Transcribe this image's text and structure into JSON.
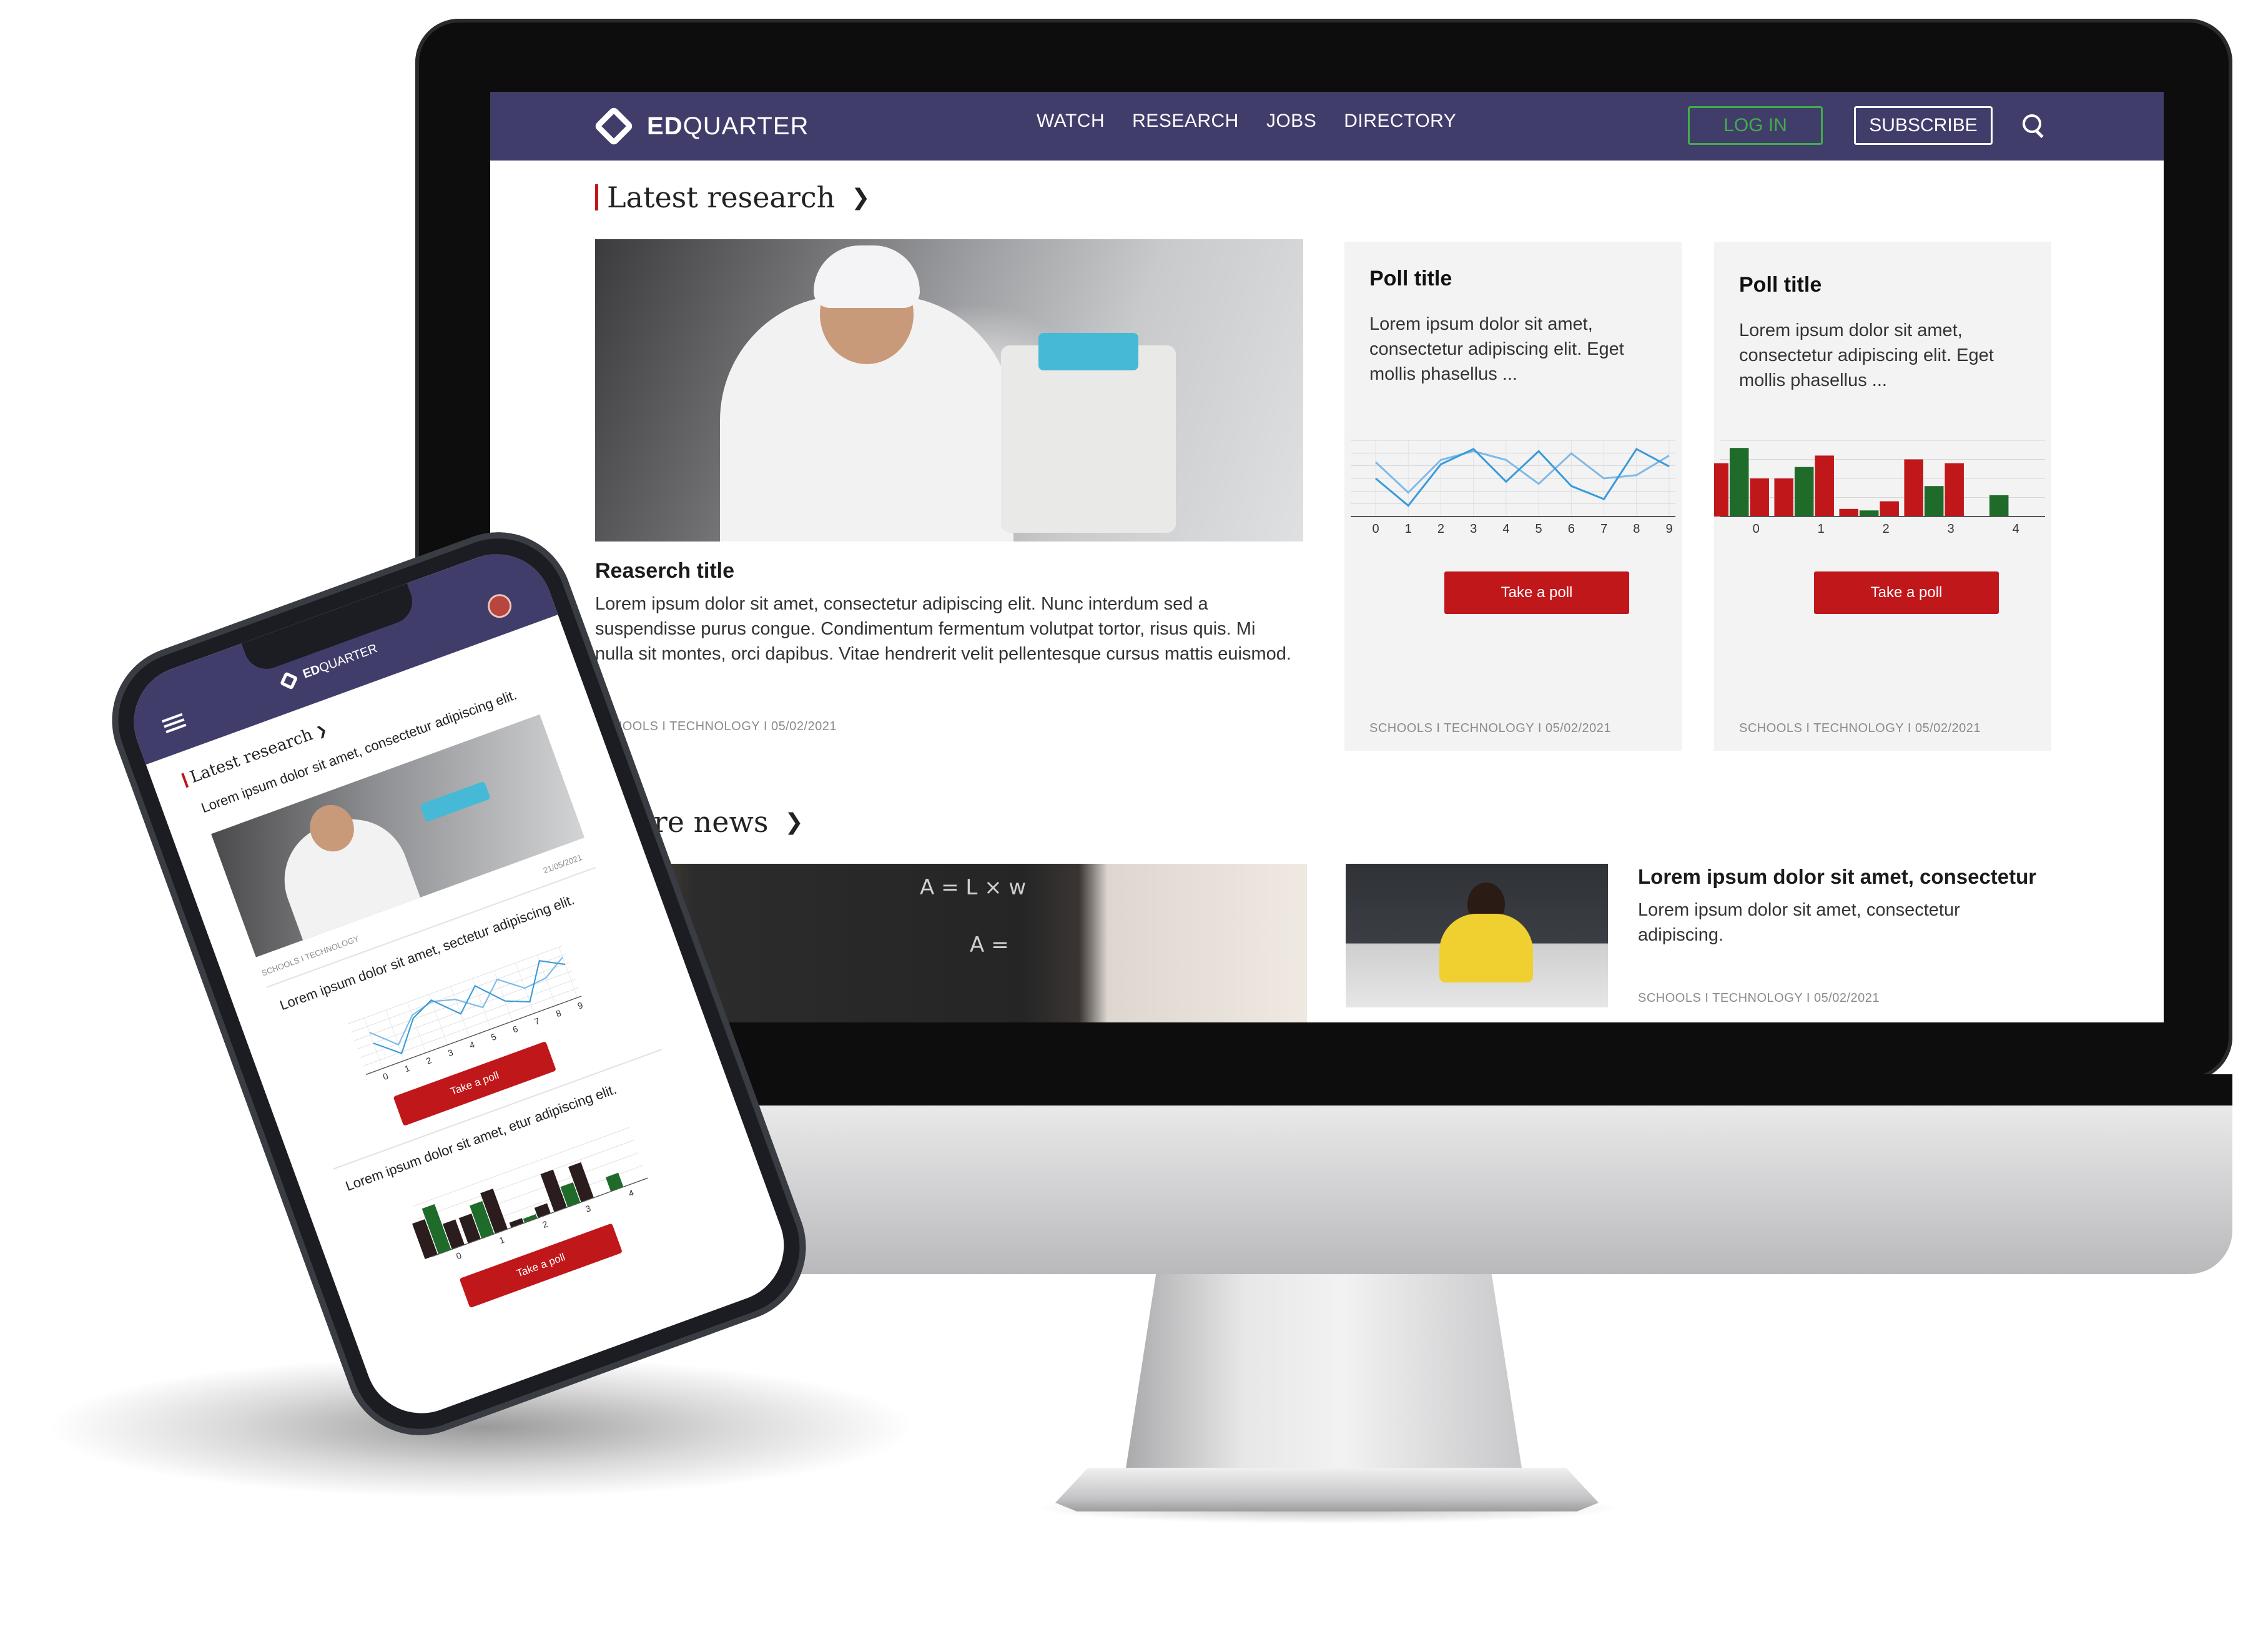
{
  "colors": {
    "brand_nav": "#413d6b",
    "accent_red": "#c0171b",
    "login_green": "#3fae49",
    "bar_green": "#1e6b2a",
    "bar_dark": "#2b1d1d",
    "line_blue": "#3a9ad9"
  },
  "desktop": {
    "brand": {
      "bold": "ED",
      "rest": "QUARTER"
    },
    "nav": [
      "WATCH",
      "RESEARCH",
      "JOBS",
      "DIRECTORY"
    ],
    "login_label": "LOG IN",
    "subscribe_label": "SUBSCRIBE",
    "search_icon": "search-icon",
    "latest_research": {
      "heading": "Latest research",
      "title": "Reaserch title",
      "body": "Lorem ipsum dolor sit amet, consectetur adipiscing elit. Nunc interdum sed a suspendisse purus congue. Condimentum fermentum volutpat tortor, risus quis. Mi nulla sit montes, orci dapibus. Vitae hendrerit velit pellentesque cursus mattis euismod.",
      "meta": "SCHOOLS  I  TECHNOLOGY  I  05/02/2021"
    },
    "polls": [
      {
        "title": "Poll title",
        "body": "Lorem ipsum dolor sit amet, consectetur adipiscing elit. Eget mollis phasellus ...",
        "button": "Take a poll",
        "meta": "SCHOOLS  I  TECHNOLOGY  I  05/02/2021"
      },
      {
        "title": "Poll title",
        "body": "Lorem ipsum dolor sit amet, consectetur adipiscing elit. Eget mollis phasellus ...",
        "button": "Take a poll",
        "meta": "SCHOOLS  I  TECHNOLOGY  I  05/02/2021"
      }
    ],
    "more_news": {
      "heading": "More news",
      "board_text": [
        "A = L × w",
        "A ="
      ],
      "item": {
        "title": "Lorem ipsum dolor sit amet, consectetur",
        "body": "Lorem ipsum dolor sit amet, consectetur adipiscing.",
        "meta": "SCHOOLS  I  TECHNOLOGY  I  05/02/2021"
      }
    }
  },
  "phone": {
    "brand": {
      "bold": "ED",
      "rest": "QUARTER"
    },
    "section": "Latest research",
    "lead": "Lorem ipsum dolor sit amet, consectetur adipiscing elit.",
    "meta_left": "SCHOOLS  I  TECHNOLOGY",
    "meta_right": "21/05/2021",
    "poll1_text": "Lorem ipsum dolor sit amet, sectetur adipiscing elit.",
    "poll1_button": "Take a poll",
    "poll2_text": "Lorem ipsum dolor sit amet, etur adipiscing elit.",
    "poll2_button": "Take a poll"
  },
  "chart_data": [
    {
      "type": "line",
      "x": [
        0,
        1,
        2,
        3,
        4,
        5,
        6,
        7,
        8,
        9
      ],
      "series": [
        {
          "values": [
            5.0,
            2.2,
            5.2,
            6.0,
            5.2,
            3.0,
            5.8,
            3.5,
            3.8,
            5.6
          ]
        },
        {
          "values": [
            3.5,
            1.0,
            4.8,
            6.2,
            3.2,
            6.0,
            2.8,
            1.6,
            6.2,
            4.6
          ]
        }
      ],
      "ylim": [
        0,
        7
      ],
      "grid": true
    },
    {
      "type": "bar",
      "categories": [
        "0",
        "1",
        "2",
        "3",
        "4"
      ],
      "series": [
        {
          "color": "#c0171b",
          "values": [
            7.0,
            5.0,
            1.0,
            7.5
          ]
        },
        {
          "color": "#1e6b2a",
          "values": [
            9.0,
            6.5,
            0.8,
            4.0,
            2.8
          ]
        },
        {
          "color": "#c0171b",
          "values": [
            5.0,
            8.0,
            2.0,
            7.0
          ]
        }
      ],
      "ylim": [
        0,
        10
      ],
      "grid": true
    }
  ]
}
